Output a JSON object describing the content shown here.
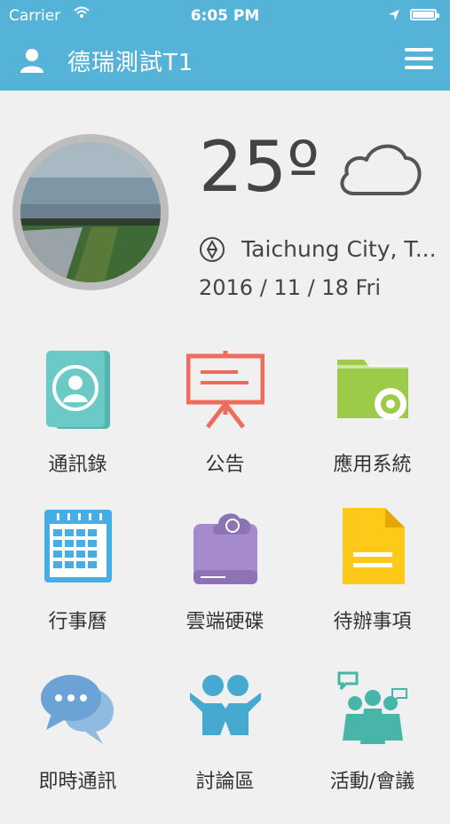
{
  "status_bar": {
    "carrier": "Carrier",
    "time": "6:05 PM"
  },
  "nav": {
    "title": "德瑞測試T1"
  },
  "weather": {
    "temperature": "25º",
    "condition": "cloudy",
    "location": "Taichung City, T...",
    "date": "2016 / 11 / 18 Fri"
  },
  "apps": [
    {
      "label": "通訊錄",
      "icon": "contacts-book-icon",
      "color": "#6ccac6"
    },
    {
      "label": "公告",
      "icon": "presentation-board-icon",
      "color": "#ee6b5d"
    },
    {
      "label": "應用系統",
      "icon": "gear-folder-icon",
      "color": "#9ccb4a"
    },
    {
      "label": "行事曆",
      "icon": "calendar-icon",
      "color": "#45aee6"
    },
    {
      "label": "雲端硬碟",
      "icon": "cloud-drive-icon",
      "color": "#a58bcc"
    },
    {
      "label": "待辦事項",
      "icon": "document-icon",
      "color": "#ffc91a"
    },
    {
      "label": "即時通訊",
      "icon": "chat-bubbles-icon",
      "color": "#6ba3d6"
    },
    {
      "label": "討論區",
      "icon": "people-discussion-icon",
      "color": "#45a9d0"
    },
    {
      "label": "活動/會議",
      "icon": "group-meeting-icon",
      "color": "#47b5a7"
    }
  ]
}
